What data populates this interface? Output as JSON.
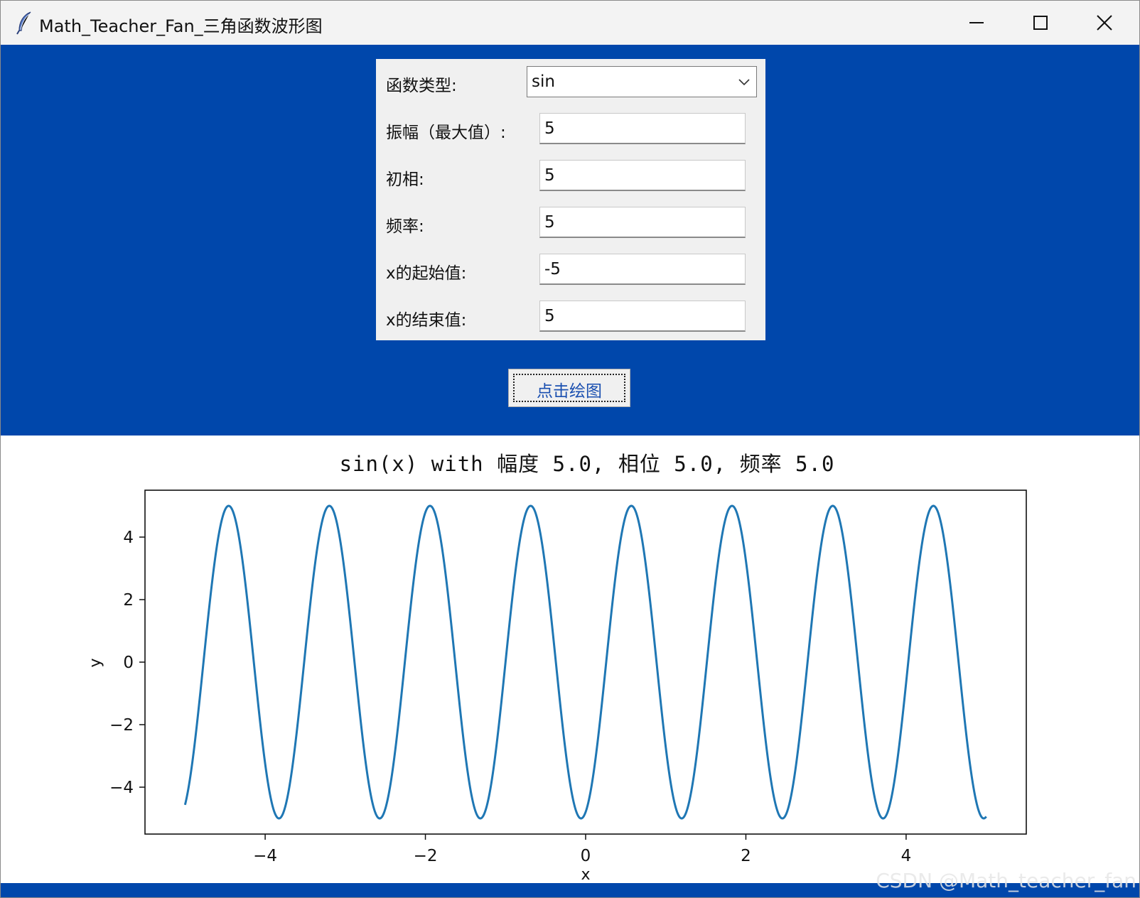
{
  "window": {
    "title": "Math_Teacher_Fan_三角函数波形图"
  },
  "form": {
    "func_type_label": "函数类型:",
    "func_type_value": "sin",
    "amplitude_label": "振幅（最大值）:",
    "amplitude_value": "5",
    "phase_label": "初相:",
    "phase_value": "5",
    "frequency_label": "频率:",
    "frequency_value": "5",
    "x_start_label": "x的起始值:",
    "x_start_value": "-5",
    "x_end_label": "x的结束值:",
    "x_end_value": "5"
  },
  "button": {
    "plot_label": "点击绘图"
  },
  "colors": {
    "window_bg": "#0047ab",
    "line": "#1f77b4"
  },
  "chart_data": {
    "type": "line",
    "title": "sin(x) with 幅度 5.0, 相位 5.0, 频率 5.0",
    "xlabel": "x",
    "ylabel": "y",
    "function": "y = 5 * sin(5 * x + 5)",
    "x_range": [
      -5,
      5
    ],
    "series": [
      {
        "x": [
          -5.0,
          -4.9,
          -4.8,
          -4.7,
          -4.6,
          -4.5,
          -4.4,
          -4.3,
          -4.2,
          -4.1,
          -4.0,
          -3.9,
          -3.8,
          -3.7,
          -3.6,
          -3.5,
          -3.4,
          -3.3,
          -3.2,
          -3.1,
          -3.0,
          -2.9,
          -2.8,
          -2.7,
          -2.6,
          -2.5,
          -2.4,
          -2.3,
          -2.2,
          -2.1,
          -2.0,
          -1.9,
          -1.8,
          -1.7,
          -1.6,
          -1.5,
          -1.4,
          -1.3,
          -1.2,
          -1.1,
          -1.0,
          -0.9,
          -0.8,
          -0.7,
          -0.6,
          -0.5,
          -0.4,
          -0.3,
          -0.2,
          -0.1,
          0.0,
          0.1,
          0.2,
          0.3,
          0.4,
          0.5,
          0.6,
          0.7,
          0.8,
          0.9,
          1.0,
          1.1,
          1.2,
          1.3,
          1.4,
          1.5,
          1.6,
          1.7,
          1.8,
          1.9,
          2.0,
          2.1,
          2.2,
          2.3,
          2.4,
          2.5,
          2.6,
          2.7,
          2.8,
          2.9,
          3.0,
          3.1,
          3.2,
          3.3,
          3.4,
          3.5,
          3.6,
          3.7,
          3.8,
          3.9,
          4.0,
          4.1,
          4.2,
          4.3,
          4.4,
          4.5,
          4.6,
          4.7,
          4.8,
          4.9,
          5.0
        ],
        "y": [
          -4.56,
          -1.97,
          1.43,
          4.3,
          4.97,
          3.23,
          -0.05,
          -3.24,
          -4.97,
          -4.29,
          -1.41,
          1.98,
          4.57,
          4.8,
          2.71,
          -0.74,
          -3.79,
          -4.96,
          -3.7,
          -0.62,
          2.82,
          4.84,
          4.53,
          1.86,
          -1.53,
          -4.34,
          -4.97,
          -3.13,
          0.18,
          3.33,
          4.99,
          4.24,
          1.31,
          -2.07,
          -4.61,
          -4.78,
          -2.63,
          0.84,
          3.86,
          4.95,
          3.63,
          0.52,
          -2.9,
          -4.87,
          -4.5,
          -1.76,
          1.64,
          4.39,
          4.96,
          3.04,
          -0.27,
          -3.42,
          -4.99,
          -4.18,
          -1.21,
          2.17,
          4.65,
          4.75,
          2.54,
          -0.94,
          -3.92,
          -4.93,
          -3.57,
          -0.42,
          2.98,
          4.89,
          4.47,
          1.66,
          -1.74,
          -4.43,
          -4.95,
          -2.95,
          0.37,
          3.5,
          4.99,
          4.13,
          1.11,
          -2.26,
          -4.69,
          -4.72,
          -2.45,
          1.03,
          3.98,
          4.91,
          3.5,
          0.32,
          -3.06,
          -4.91,
          -4.43,
          -1.56,
          1.84,
          4.47,
          4.94,
          2.86,
          -0.47,
          -3.57,
          -4.98,
          -4.07,
          -1.01,
          2.35,
          4.72
        ]
      }
    ],
    "xlim": [
      -5.5,
      5.5
    ],
    "ylim": [
      -5.5,
      5.5
    ],
    "xticks": [
      -4,
      -2,
      0,
      2,
      4
    ],
    "yticks": [
      -4,
      -2,
      0,
      2,
      4
    ],
    "xtick_labels": [
      "−4",
      "−2",
      "0",
      "2",
      "4"
    ],
    "ytick_labels": [
      "−4",
      "−2",
      "0",
      "2",
      "4"
    ],
    "grid": false
  },
  "watermark": "CSDN @Math_teacher_fan"
}
